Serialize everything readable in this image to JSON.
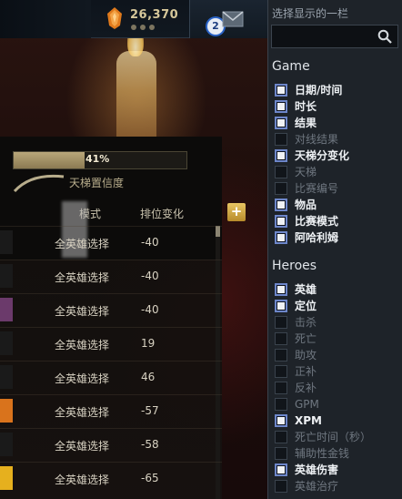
{
  "topbar": {
    "shard_count": "26,370",
    "notification_count": "2"
  },
  "match_panel": {
    "progress_percent": 41,
    "progress_label": "41%",
    "confidence_label": "天梯置信度",
    "columns": {
      "mode": "模式",
      "rank_change": "排位变化"
    },
    "add_button_label": "+",
    "rows": [
      {
        "mode": "全英雄选择",
        "change": "-40",
        "swatch": "#1a1a1a"
      },
      {
        "mode": "全英雄选择",
        "change": "-40",
        "swatch": "#1a1a1a"
      },
      {
        "mode": "全英雄选择",
        "change": "-40",
        "swatch": "#6b3a6b"
      },
      {
        "mode": "全英雄选择",
        "change": "19",
        "swatch": "#1a1a1a"
      },
      {
        "mode": "全英雄选择",
        "change": "46",
        "swatch": "#1a1a1a"
      },
      {
        "mode": "全英雄选择",
        "change": "-57",
        "swatch": "#d9731c"
      },
      {
        "mode": "全英雄选择",
        "change": "-58",
        "swatch": "#1a1a1a"
      },
      {
        "mode": "全英雄选择",
        "change": "-65",
        "swatch": "#e6b01e"
      }
    ]
  },
  "chooser": {
    "title": "选择显示的一栏",
    "search_placeholder": "",
    "groups": [
      {
        "title": "Game",
        "options": [
          {
            "label": "日期/时间",
            "checked": true
          },
          {
            "label": "时长",
            "checked": true
          },
          {
            "label": "结果",
            "checked": true
          },
          {
            "label": "对线结果",
            "checked": false
          },
          {
            "label": "天梯分变化",
            "checked": true
          },
          {
            "label": "天梯",
            "checked": false
          },
          {
            "label": "比赛编号",
            "checked": false
          },
          {
            "label": "物品",
            "checked": true
          },
          {
            "label": "比赛模式",
            "checked": true
          },
          {
            "label": "阿哈利姆",
            "checked": true
          }
        ]
      },
      {
        "title": "Heroes",
        "options": [
          {
            "label": "英雄",
            "checked": true
          },
          {
            "label": "定位",
            "checked": true
          },
          {
            "label": "击杀",
            "checked": false
          },
          {
            "label": "死亡",
            "checked": false
          },
          {
            "label": "助攻",
            "checked": false
          },
          {
            "label": "正补",
            "checked": false
          },
          {
            "label": "反补",
            "checked": false
          },
          {
            "label": "GPM",
            "checked": false
          },
          {
            "label": "XPM",
            "checked": true
          },
          {
            "label": "死亡时间（秒）",
            "checked": false
          },
          {
            "label": "辅助性金钱",
            "checked": false
          },
          {
            "label": "英雄伤害",
            "checked": true
          },
          {
            "label": "英雄治疗",
            "checked": false
          }
        ]
      }
    ]
  },
  "colors": {
    "accent_gold": "#e8c563",
    "checkbox_border": "#6d86c9"
  }
}
